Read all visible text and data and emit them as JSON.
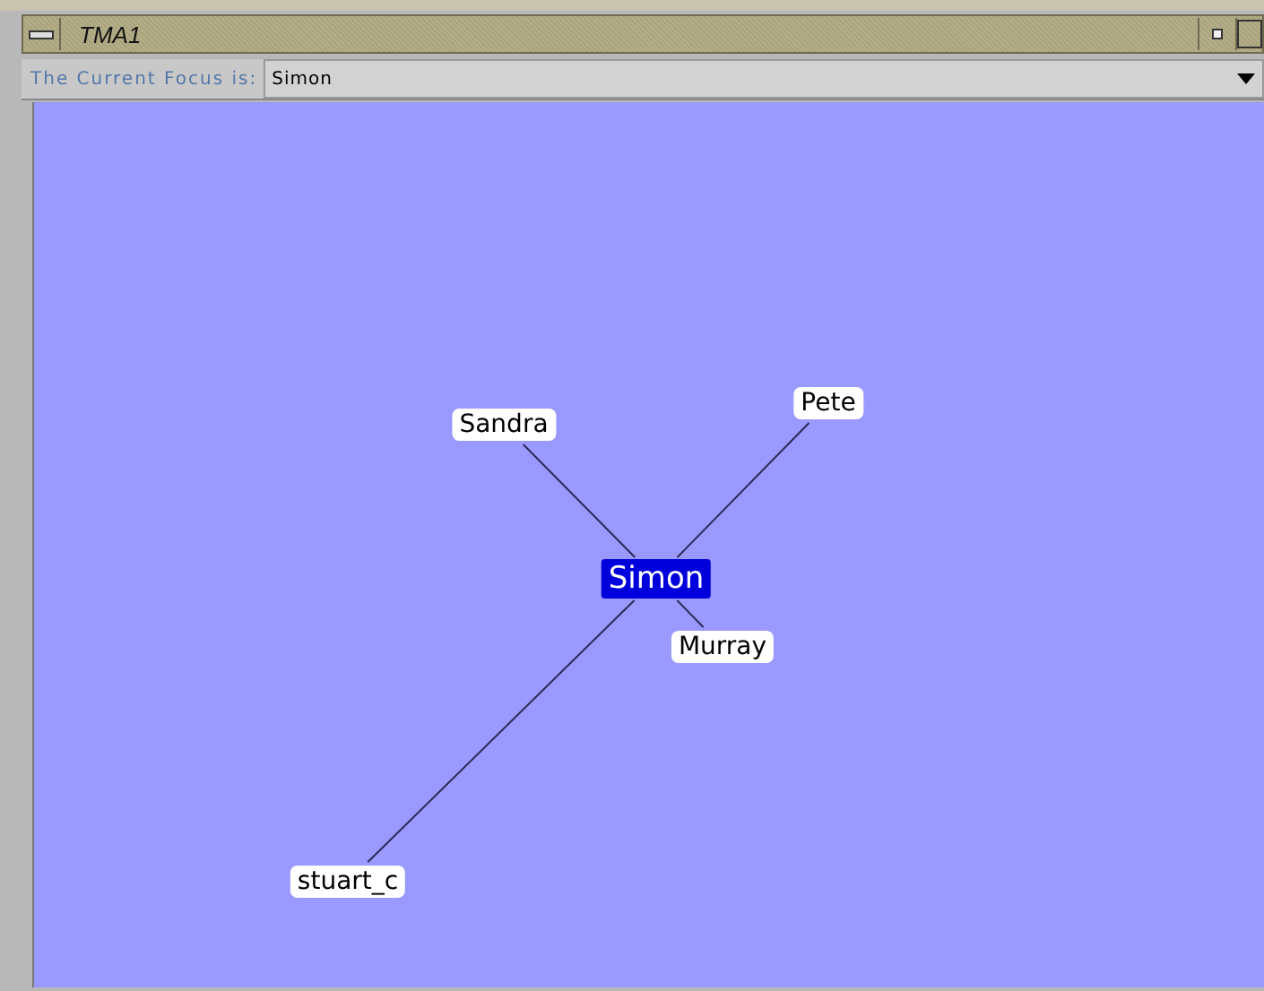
{
  "window": {
    "title": "TMA1"
  },
  "focus": {
    "label": "The Current Focus is:",
    "value": "Simon"
  },
  "nodes": [
    {
      "label": "Sandra",
      "selected": false
    },
    {
      "label": "Pete",
      "selected": false
    },
    {
      "label": "Simon",
      "selected": true
    },
    {
      "label": "Murray",
      "selected": false
    },
    {
      "label": "stuart_c",
      "selected": false
    }
  ]
}
